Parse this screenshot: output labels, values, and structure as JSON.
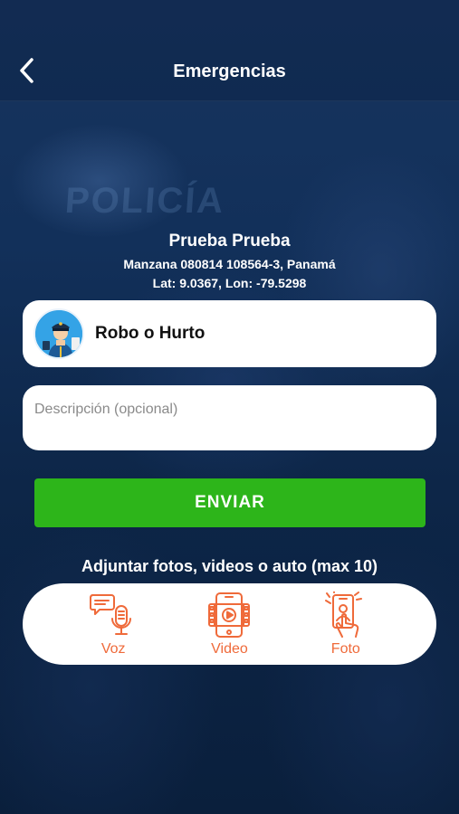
{
  "header": {
    "title": "Emergencias",
    "back_icon": "chevron-left-icon"
  },
  "background": {
    "watermark": "POLICÍA"
  },
  "user": {
    "name": "Prueba Prueba",
    "address": "Manzana 080814 108564-3, Panamá",
    "coords": "Lat: 9.0367,  Lon: -79.5298"
  },
  "incident": {
    "type_label": "Robo o Hurto",
    "icon": "police-officer-icon"
  },
  "description": {
    "placeholder": "Descripción (opcional)",
    "value": ""
  },
  "actions": {
    "send_label": "ENVIAR"
  },
  "attachments": {
    "label": "Adjuntar fotos, videos o auto (max 10)",
    "options": [
      {
        "label": "Voz",
        "icon": "microphone-chat-icon"
      },
      {
        "label": "Video",
        "icon": "video-film-icon"
      },
      {
        "label": "Foto",
        "icon": "phone-camera-icon"
      }
    ]
  },
  "colors": {
    "accent_green": "#2db51a",
    "accent_orange": "#ef6a3a",
    "background_navy": "#0f2a4e"
  }
}
